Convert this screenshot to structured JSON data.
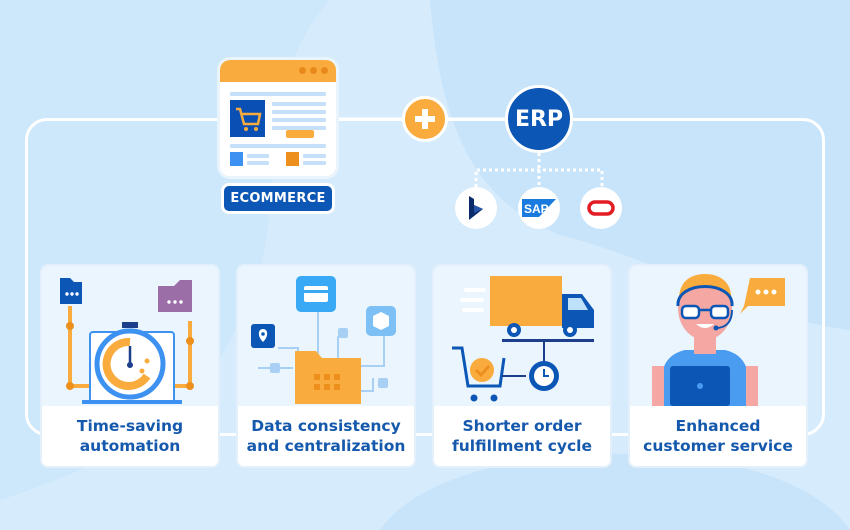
{
  "colors": {
    "background": "#d6ebfb",
    "primary_blue": "#0c56b6",
    "accent_orange": "#f9ac3d",
    "label_text": "#1559ad",
    "frame": "#ffffff"
  },
  "ecommerce": {
    "label": "ECOMMERCE",
    "icon": "browser-window-shopping-cart-icon"
  },
  "connector": {
    "icon": "plus-icon"
  },
  "erp": {
    "label": "ERP",
    "vendors": [
      {
        "name": "Microsoft Dynamics",
        "icon": "dynamics-logo-icon"
      },
      {
        "name": "SAP",
        "icon": "sap-logo-icon",
        "text": "SAP"
      },
      {
        "name": "Oracle",
        "icon": "oracle-logo-icon"
      }
    ]
  },
  "benefits": [
    {
      "line1": "Time-saving",
      "line2": "automation",
      "icon": "stopwatch-automation-icon"
    },
    {
      "line1": "Data consistency",
      "line2": "and centralization",
      "icon": "data-folder-network-icon"
    },
    {
      "line1": "Shorter order",
      "line2": "fulfillment cycle",
      "icon": "delivery-truck-cart-icon"
    },
    {
      "line1": "Enhanced",
      "line2": "customer service",
      "icon": "support-agent-icon"
    }
  ]
}
